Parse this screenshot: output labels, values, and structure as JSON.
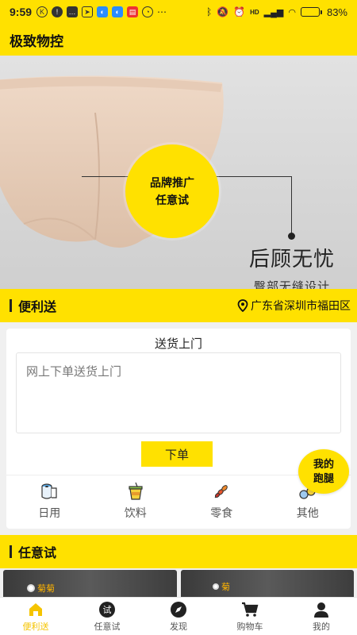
{
  "status_bar": {
    "time": "9:59",
    "network": "HD",
    "battery_percent": "83%",
    "battery_level": 0.83
  },
  "header": {
    "title": "极致物控"
  },
  "banner": {
    "bubble_line1": "品牌推广",
    "bubble_line2": "任意试",
    "slogan": "后顾无忧",
    "sub_slogan": "臀部无缝设计"
  },
  "delivery_section": {
    "title": "便利送",
    "location": "广东省深圳市福田区"
  },
  "delivery_card": {
    "title": "送货上门",
    "placeholder": "网上下单送货上门",
    "submit_label": "下单",
    "categories": [
      {
        "label": "日用",
        "icon": "toilet-paper-icon"
      },
      {
        "label": "饮料",
        "icon": "drink-cup-icon"
      },
      {
        "label": "零食",
        "icon": "snack-icon"
      },
      {
        "label": "其他",
        "icon": "other-icon"
      }
    ]
  },
  "runner_badge": {
    "line1": "我的",
    "line2": "跑腿"
  },
  "trial_section": {
    "title": "任意试"
  },
  "thumbnails": [
    {
      "tag": "菊菊"
    },
    {
      "tag": "菊"
    }
  ],
  "tab_bar": {
    "active_color": "#f5c400",
    "tabs": [
      {
        "label": "便利送",
        "icon": "home-icon",
        "active": true
      },
      {
        "label": "任意试",
        "icon": "trial-icon",
        "badge_text": "试"
      },
      {
        "label": "发现",
        "icon": "compass-icon"
      },
      {
        "label": "购物车",
        "icon": "cart-icon"
      },
      {
        "label": "我的",
        "icon": "user-icon"
      }
    ]
  },
  "colors": {
    "brand_yellow": "#ffe100"
  }
}
